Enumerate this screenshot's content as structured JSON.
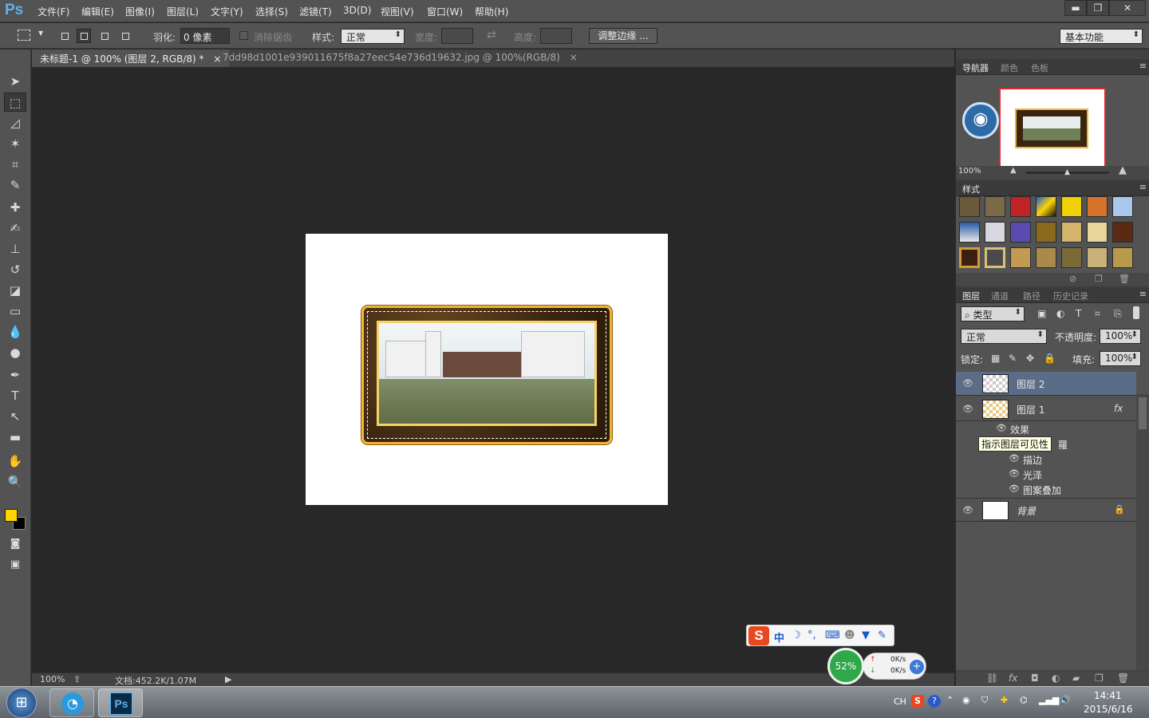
{
  "app": {
    "logo": "Ps"
  },
  "menu": [
    "文件(F)",
    "编辑(E)",
    "图像(I)",
    "图层(L)",
    "文字(Y)",
    "选择(S)",
    "滤镜(T)",
    "3D(D)",
    "视图(V)",
    "窗口(W)",
    "帮助(H)"
  ],
  "window_buttons": {
    "minimize": "▬",
    "restore": "❐",
    "close": "✕"
  },
  "options": {
    "feather_label": "羽化:",
    "feather_value": "0 像素",
    "antialias_label": "消除锯齿",
    "style_label": "样式:",
    "style_value": "正常",
    "width_label": "宽度:",
    "height_label": "高度:",
    "refine_button": "调整边缘 ...",
    "workspace": "基本功能"
  },
  "tabs": [
    {
      "label": "未标题-1 @ 100% (图层 2, RGB/8) *",
      "close": "×"
    },
    {
      "label": "7dd98d1001e939011675f8a27eec54e736d19632.jpg @ 100%(RGB/8)",
      "close": "×"
    }
  ],
  "statusbar": {
    "zoom": "100%",
    "doc": "文档:452.2K/1.07M"
  },
  "navigator": {
    "tabs": [
      "导航器",
      "颜色",
      "色板"
    ],
    "zoom": "100%"
  },
  "styles_panel": {
    "tab": "样式"
  },
  "layers_panel": {
    "tabs": [
      "图层",
      "通道",
      "路径",
      "历史记录"
    ],
    "filter_label": "类型",
    "blend_mode": "正常",
    "opacity_label": "不透明度:",
    "opacity_value": "100%",
    "lock_label": "锁定:",
    "fill_label": "填充:",
    "fill_value": "100%",
    "layers": [
      {
        "name": "图层 2"
      },
      {
        "name": "图层 1",
        "fx": "fx"
      },
      {
        "name": "背景"
      }
    ],
    "effects_label": "效果",
    "effects": [
      "描边",
      "光泽",
      "图案叠加"
    ],
    "tooltip": "指示图层可见性",
    "tooltip_trailing": "羅"
  },
  "ime": {
    "label": "中"
  },
  "speed": {
    "percent": "52%",
    "up": "0K/s",
    "down": "0K/s"
  },
  "taskbar": {
    "lang": "CH",
    "time": "14:41",
    "date": "2015/6/16"
  },
  "colors": {
    "accent_ps": "#5eb2ec",
    "foreground": "#ffd400",
    "background": "#000000",
    "selected_layer": "#5b6d86",
    "frame_gold": "#f2b437"
  }
}
